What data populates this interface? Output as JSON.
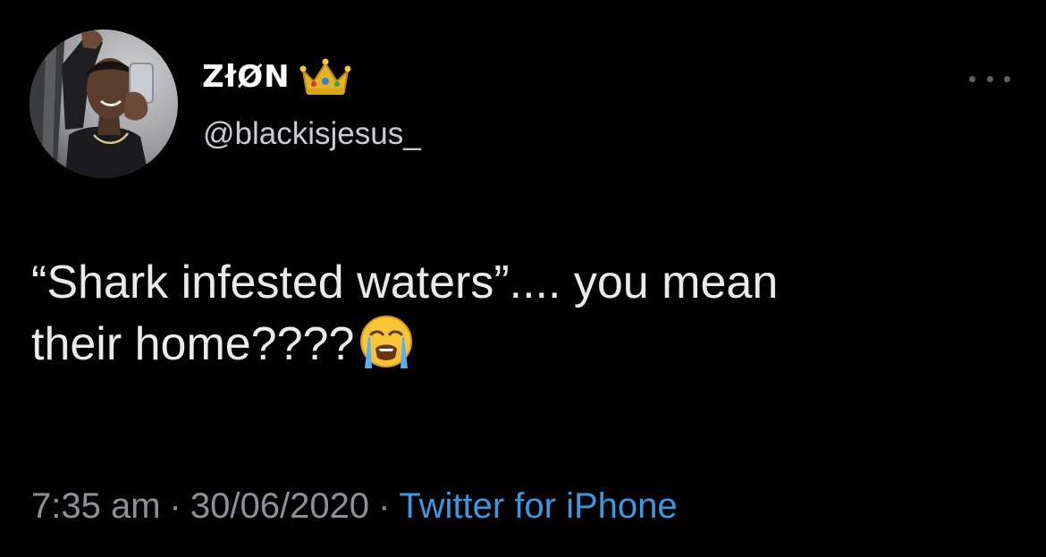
{
  "tweet": {
    "author": {
      "display_name": "ZłØN",
      "display_name_emoji": "crown-emoji",
      "handle": "@blackisjesus_",
      "avatar": "profile-photo"
    },
    "text_line_1": "“Shark infested waters”.... you mean",
    "text_line_2": "their home????",
    "text_emoji": "loudly-crying-face-emoji",
    "time": "7:35 am",
    "separator": "·",
    "date": "30/06/2020",
    "source": "Twitter for iPhone",
    "more_menu_icon": "more-dots-icon"
  },
  "colors": {
    "background": "#000000",
    "text": "#e9eaec",
    "secondary_text": "#8b9196",
    "link": "#3f97e0"
  }
}
